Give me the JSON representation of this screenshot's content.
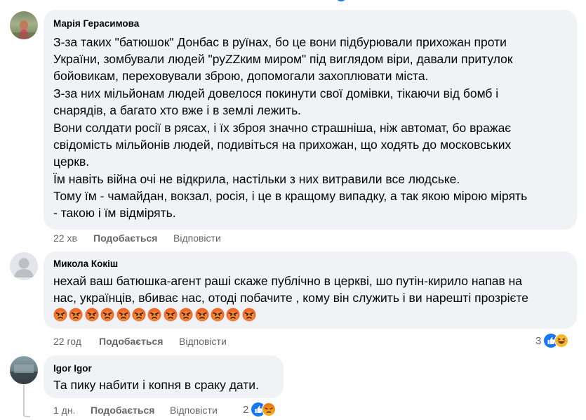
{
  "comments": [
    {
      "author": "Марія Герасимова",
      "lines": [
        "З-за таких \"батюшок\" Донбас в руїнах, бо це вони підбурювали прихожан проти",
        "України, зомбували людей \"руZZким миром\" під виглядом віри, давали притулок",
        "бойовикам, переховували зброю, допомогали захоплювати міста.",
        "З-за них мільйонам людей довелося покинути свої домівки, тікаючи від бомб і",
        "снарядів, а багато хто вже і в землі лежить.",
        "Вони солдати росії в рясах, і їх зброя значно страшніша, ніж автомат, бо вражає",
        "свідомість мільйонів людей, подивіться на прихожан, що ходять до московських",
        "церкв.",
        "Їм навіть війна очі не відкрила, настільки з них витравили все людське.",
        "Тому їм - чамайдан, вокзал, росія, і це в кращому випадку, а так якою мірою мірять",
        "- такою і їм відмірять."
      ],
      "time": "22 хв",
      "like": "Подобається",
      "reply": "Відповісти"
    },
    {
      "author": "Микола Кокіш",
      "lines": [
        "нехай ваш батюшка-агент раші скаже публічно в церкві, шо путін-кирило напав на",
        "нас, українців, вбиває нас, отоді побачите , кому він служить і ви нарешті прозрієте"
      ],
      "emoji_count": 13,
      "emoji_name": "angry-face-emoji",
      "time": "22 год",
      "like": "Подобається",
      "reply": "Відповісти",
      "reactions_count": "3",
      "reactions": [
        "like-icon",
        "haha-icon"
      ]
    },
    {
      "author": "Igor Igor",
      "lines": [
        "Та пику набити і копня в сраку дати."
      ],
      "time": "1 дн.",
      "like": "Подобається",
      "reply": "Відповісти",
      "reactions_count": "2",
      "reactions": [
        "like-icon",
        "angry-icon"
      ]
    }
  ],
  "colors": {
    "bubble": "#f0f2f5",
    "secondary_text": "#65676b",
    "like_blue": "#1877f2",
    "angry_orange": "#e9710f"
  }
}
